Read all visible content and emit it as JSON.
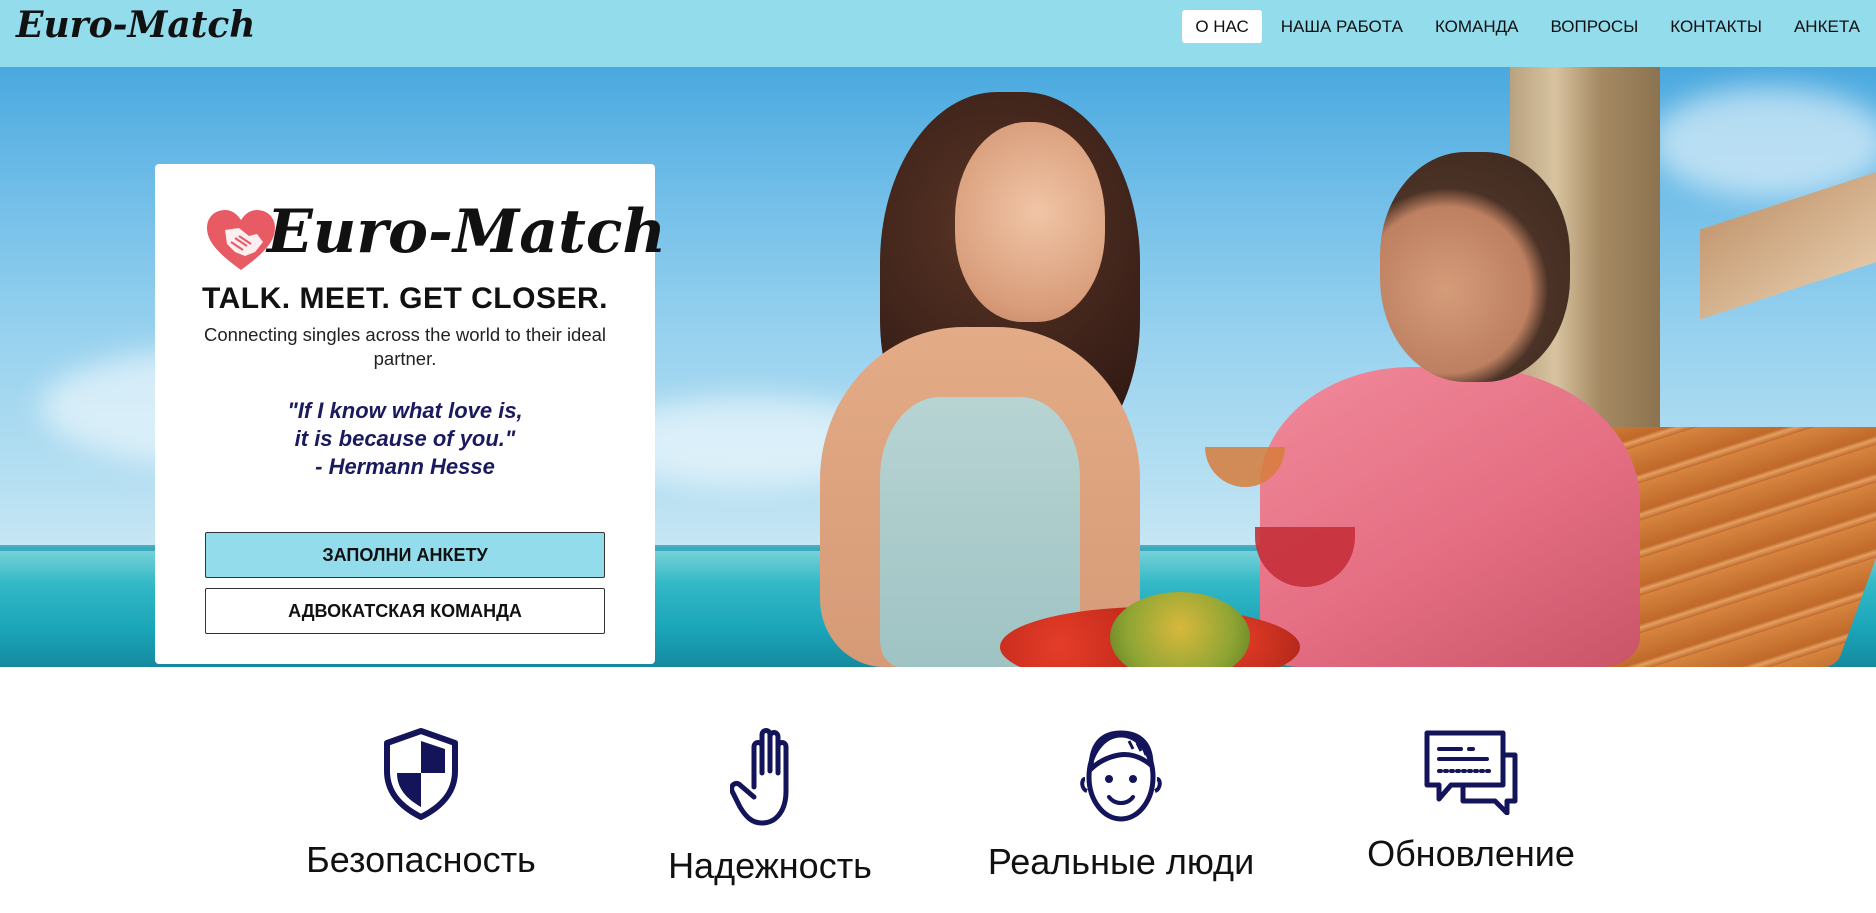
{
  "navbar": {
    "brand": "Euro-Match",
    "items": [
      {
        "label": "О НАС",
        "active": true
      },
      {
        "label": "НАША РАБОТА",
        "active": false
      },
      {
        "label": "КОМАНДА",
        "active": false
      },
      {
        "label": "ВОПРОСЫ",
        "active": false
      },
      {
        "label": "КОНТАКТЫ",
        "active": false
      },
      {
        "label": "АНКЕТА",
        "active": false
      }
    ]
  },
  "hero_card": {
    "logo_text": "Euro-Match",
    "logo_icon": "heart-handshake-icon",
    "tagline": "TALK. MEET. GET CLOSER.",
    "subtitle": "Connecting singles across the world to their ideal partner.",
    "quote_line1": "\"If I know what love is,",
    "quote_line2": "it is because of you.\"",
    "quote_author": "- Hermann Hesse",
    "primary_button": "ЗАПОЛНИ АНКЕТУ",
    "secondary_button": "АДВОКАТСКАЯ КОМАНДА"
  },
  "features": [
    {
      "label": "Безопасность",
      "icon": "shield-icon"
    },
    {
      "label": "Надежность",
      "icon": "hand-icon"
    },
    {
      "label": "Реальные люди",
      "icon": "face-icon"
    },
    {
      "label": "Обновление",
      "icon": "chat-icon"
    }
  ],
  "colors": {
    "navbar_bg": "#92dcec",
    "accent": "#92dcec",
    "icon_navy": "#14145a",
    "quote_navy": "#1a1a5e"
  }
}
